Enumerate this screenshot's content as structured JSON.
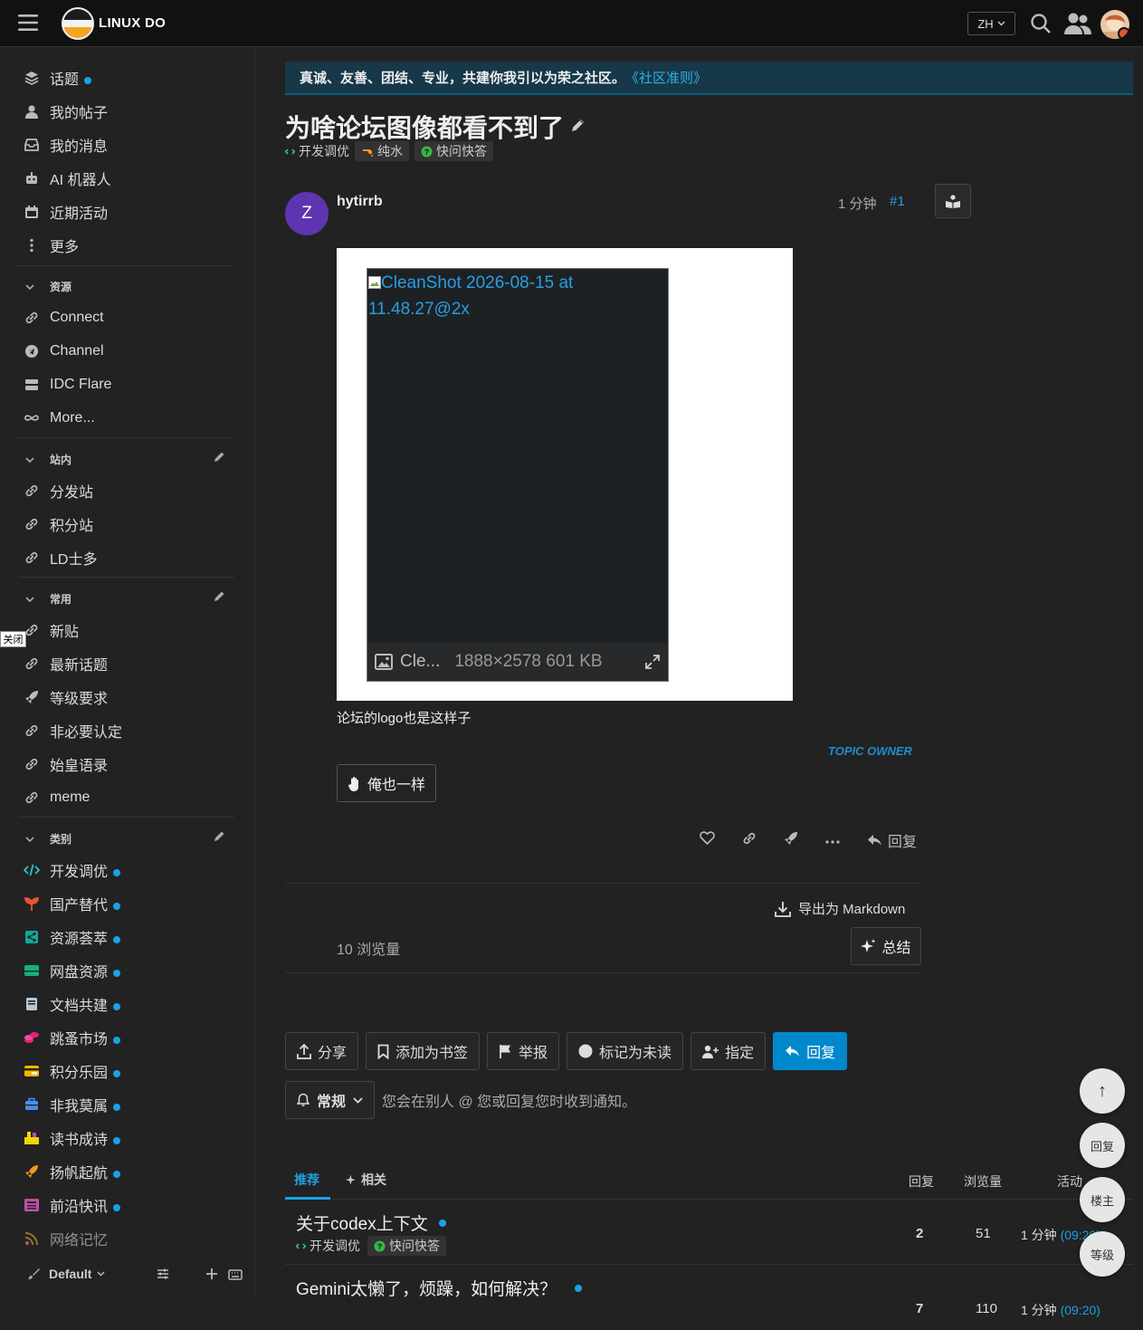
{
  "header": {
    "brand": "LINUX DO",
    "lang": "ZH",
    "icons": [
      "hamburger-icon",
      "search-icon",
      "users-icon",
      "avatar"
    ]
  },
  "sidebar": {
    "top": [
      {
        "label": "话题",
        "icon": "layers-icon",
        "dot": true
      },
      {
        "label": "我的帖子",
        "icon": "user-icon"
      },
      {
        "label": "我的消息",
        "icon": "inbox-icon"
      },
      {
        "label": "AI 机器人",
        "icon": "robot-icon"
      },
      {
        "label": "近期活动",
        "icon": "calendar-icon"
      },
      {
        "label": "更多",
        "icon": "more-vertical-icon"
      }
    ],
    "resources_title": "资源",
    "resources": [
      {
        "label": "Connect",
        "icon": "link-icon"
      },
      {
        "label": "Channel",
        "icon": "telegram-icon"
      },
      {
        "label": "IDC Flare",
        "icon": "server-icon"
      },
      {
        "label": "More...",
        "icon": "infinity-icon"
      }
    ],
    "site_title": "站内",
    "site": [
      {
        "label": "分发站",
        "icon": "link-icon"
      },
      {
        "label": "积分站",
        "icon": "link-icon"
      },
      {
        "label": "LD士多",
        "icon": "link-icon"
      }
    ],
    "common_title": "常用",
    "common": [
      {
        "label": "新贴",
        "icon": "link-icon"
      },
      {
        "label": "最新话题",
        "icon": "link-icon"
      },
      {
        "label": "等级要求",
        "icon": "rocket-icon"
      },
      {
        "label": "非必要认定",
        "icon": "link-icon"
      },
      {
        "label": "始皇语录",
        "icon": "link-icon"
      },
      {
        "label": "meme",
        "icon": "link-icon"
      }
    ],
    "categories_title": "类别",
    "categories": [
      {
        "label": "开发调优",
        "icon": "code-icon",
        "color": "#32c3c3"
      },
      {
        "label": "国产替代",
        "icon": "sprout-icon",
        "color": "#e45735"
      },
      {
        "label": "资源荟萃",
        "icon": "share-icon",
        "color": "#12a89d"
      },
      {
        "label": "网盘资源",
        "icon": "drive-icon",
        "color": "#16b176"
      },
      {
        "label": "文档共建",
        "icon": "book-icon",
        "color": "#9eb83b"
      },
      {
        "label": "跳蚤市场",
        "icon": "coins-icon",
        "color": "#ed207b"
      },
      {
        "label": "积分乐园",
        "icon": "card-icon",
        "color": "#f7b300"
      },
      {
        "label": "非我莫属",
        "icon": "briefcase-icon",
        "color": "#4a8fe7"
      },
      {
        "label": "读书成诗",
        "icon": "books-icon",
        "color": "#f5d400"
      },
      {
        "label": "扬帆起航",
        "icon": "rocket-icon",
        "color": "#f7941d"
      },
      {
        "label": "前沿快讯",
        "icon": "news-icon",
        "color": "#bf4ea8"
      },
      {
        "label": "网络记忆",
        "icon": "rss-icon",
        "color": "#e6a23c"
      }
    ],
    "tooltip": "关闭",
    "footer_theme": "Default"
  },
  "banner": {
    "text": "真诚、友善、团结、专业，共建你我引以为荣之社区。",
    "link": "《社区准则》"
  },
  "topic": {
    "title": "为啥论坛图像都看不到了",
    "tags": [
      {
        "label": "开发调优",
        "icon": "code-icon"
      },
      {
        "label": "纯水",
        "icon": "water-icon"
      },
      {
        "label": "快问快答",
        "icon": "question-icon"
      }
    ]
  },
  "post": {
    "avatar_letter": "Z",
    "username": "hytirrb",
    "time": "1 分钟",
    "number": "#1",
    "image_alt": "CleanShot 2026-08-15 at 11.48.27@2x",
    "image_name": "Cle...",
    "image_info": "1888×2578 601 KB",
    "text": "论坛的logo也是这样子",
    "owner_badge": "TOPIC OWNER",
    "metoo": "俺也一样",
    "reply": "回复",
    "export": "导出为 Markdown",
    "views": "10 浏览量",
    "summary": "总结"
  },
  "topic_buttons": {
    "share": "分享",
    "bookmark": "添加为书签",
    "flag": "举报",
    "unread": "标记为未读",
    "assign": "指定",
    "reply": "回复"
  },
  "notification": {
    "level": "常规",
    "text": "您会在别人 @ 您或回复您时收到通知。"
  },
  "related": {
    "tab_recommended": "推荐",
    "tab_related": "相关",
    "col_replies": "回复",
    "col_views": "浏览量",
    "col_activity": "活动",
    "rows": [
      {
        "title": "关于codex上下文",
        "tags": [
          "开发调优",
          "快问快答"
        ],
        "replies": "2",
        "views": "51",
        "activity": "1 分钟",
        "time": "(09:20)"
      },
      {
        "title": "Gemini太懒了，烦躁，如何解决？",
        "tags": [],
        "replies": "7",
        "views": "110",
        "activity": "1 分钟",
        "time": "(09:20)"
      }
    ]
  },
  "fab": {
    "top": "↑",
    "reply": "回复",
    "owner": "楼主",
    "level": "等级"
  },
  "colors": {
    "accent": "#0088cc",
    "link": "#2a9de0",
    "dot": "#1ba1e2"
  }
}
